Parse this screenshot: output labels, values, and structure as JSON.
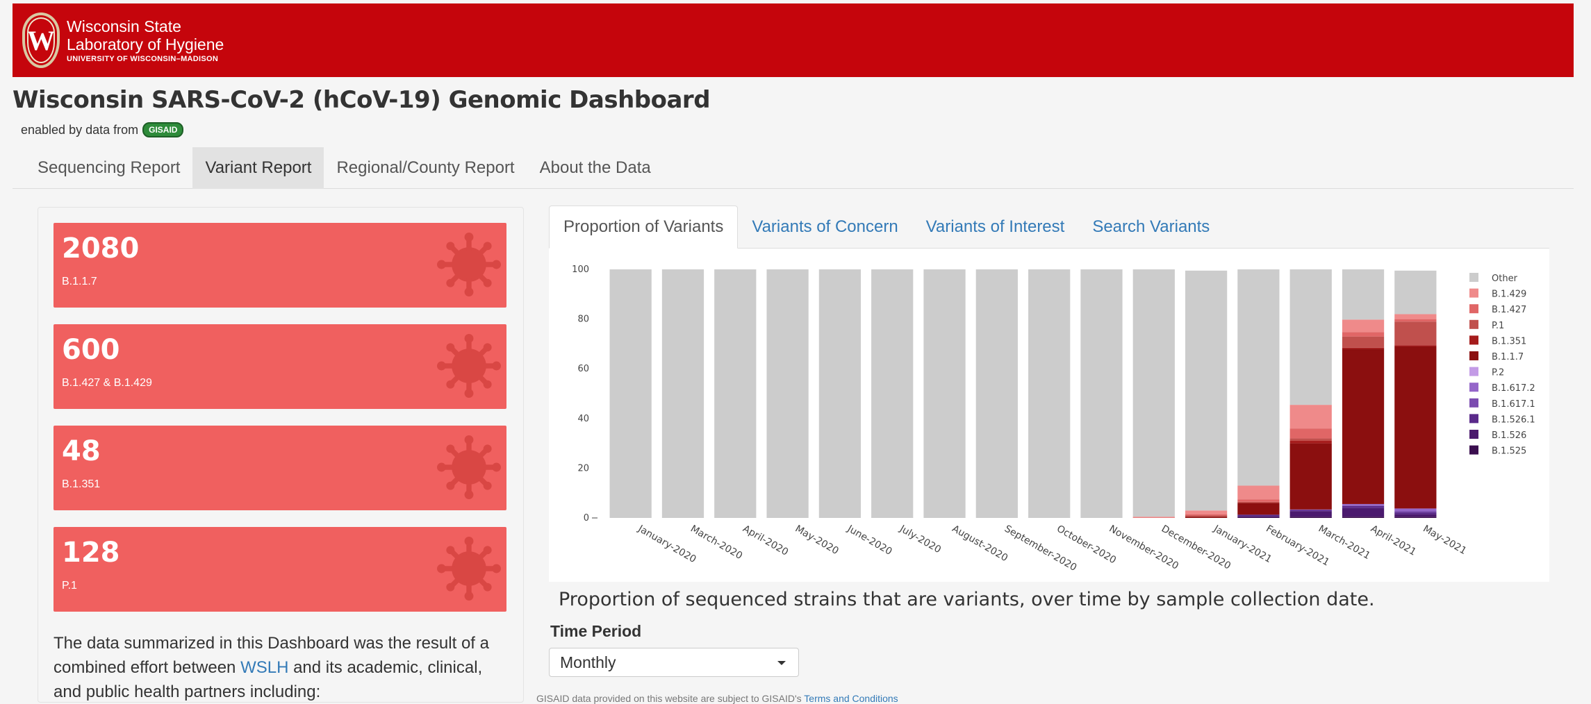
{
  "header": {
    "logo_line1": "Wisconsin State",
    "logo_line2": "Laboratory of Hygiene",
    "logo_line3": "UNIVERSITY OF WISCONSIN–MADISON",
    "logo_letter": "W",
    "brand_color": "#c5050c"
  },
  "page_title": "Wisconsin SARS-CoV-2 (hCoV-19) Genomic Dashboard",
  "enabled_by": "enabled by data from",
  "gisaid_badge": "GISAID",
  "nav_tabs": [
    {
      "label": "Sequencing Report",
      "active": false
    },
    {
      "label": "Variant Report",
      "active": true
    },
    {
      "label": "Regional/County Report",
      "active": false
    },
    {
      "label": "About the Data",
      "active": false
    }
  ],
  "variant_boxes": [
    {
      "count": "2080",
      "label": "B.1.1.7"
    },
    {
      "count": "600",
      "label": "B.1.427 & B.1.429"
    },
    {
      "count": "48",
      "label": "B.1.351"
    },
    {
      "count": "128",
      "label": "P.1"
    }
  ],
  "sidebar_text": {
    "before_link": "The data summarized in this Dashboard was the result of a combined effort between ",
    "link": "WSLH",
    "after_link": " and its academic, clinical, and public health partners including:"
  },
  "main_tabs": [
    {
      "label": "Proportion of Variants",
      "active": true
    },
    {
      "label": "Variants of Concern",
      "active": false
    },
    {
      "label": "Variants of Interest",
      "active": false
    },
    {
      "label": "Search Variants",
      "active": false
    }
  ],
  "chart_caption": "Proportion of sequenced strains that are variants, over time by sample collection date.",
  "time_period": {
    "label": "Time Period",
    "selected": "Monthly"
  },
  "footnote": {
    "text": "GISAID data provided on this website are subject to GISAID's ",
    "link": "Terms and Conditions"
  },
  "chart_data": {
    "type": "bar",
    "stacked": true,
    "ylim": [
      0,
      100
    ],
    "yticks": [
      0,
      20,
      40,
      60,
      80,
      100
    ],
    "categories": [
      "January-2020",
      "March-2020",
      "April-2020",
      "May-2020",
      "June-2020",
      "July-2020",
      "August-2020",
      "September-2020",
      "October-2020",
      "November-2020",
      "December-2020",
      "January-2021",
      "February-2021",
      "March-2021",
      "April-2021",
      "May-2021"
    ],
    "legend_position": "right",
    "series": [
      {
        "name": "B.1.525",
        "color": "#3b0f4f",
        "values": [
          0,
          0,
          0,
          0,
          0,
          0,
          0,
          0,
          0,
          0,
          0,
          0,
          0.3,
          0.5,
          0.5,
          0.5
        ]
      },
      {
        "name": "B.1.526",
        "color": "#4b1a6e",
        "values": [
          0,
          0,
          0,
          0,
          0,
          0,
          0,
          0,
          0,
          0,
          0,
          0,
          0.5,
          2.2,
          3.5,
          1.0
        ]
      },
      {
        "name": "B.1.526.1",
        "color": "#5a2a8a",
        "values": [
          0,
          0,
          0,
          0,
          0,
          0,
          0,
          0,
          0,
          0,
          0,
          0,
          0.5,
          0.5,
          0.8,
          0.8
        ]
      },
      {
        "name": "B.1.617.1",
        "color": "#7b4cb0",
        "values": [
          0,
          0,
          0,
          0,
          0,
          0,
          0,
          0,
          0,
          0,
          0,
          0,
          0,
          0,
          0.3,
          0.5
        ]
      },
      {
        "name": "B.1.617.2",
        "color": "#9466c9",
        "values": [
          0,
          0,
          0,
          0,
          0,
          0,
          0,
          0,
          0,
          0,
          0,
          0,
          0,
          0.2,
          0.5,
          1.0
        ]
      },
      {
        "name": "P.2",
        "color": "#c39be6",
        "values": [
          0,
          0,
          0,
          0,
          0,
          0,
          0,
          0,
          0,
          0,
          0,
          0,
          0,
          0,
          0,
          0
        ]
      },
      {
        "name": "B.1.1.7",
        "color": "#8b0f0f",
        "values": [
          0,
          0,
          0,
          0,
          0,
          0,
          0,
          0,
          0,
          0,
          0,
          0.5,
          4.7,
          26.6,
          62.4,
          65.2
        ]
      },
      {
        "name": "B.1.351",
        "color": "#a51c1c",
        "values": [
          0,
          0,
          0,
          0,
          0,
          0,
          0,
          0,
          0,
          0,
          0,
          0,
          0,
          1.0,
          0.5,
          0.5
        ]
      },
      {
        "name": "P.1",
        "color": "#c0504d",
        "values": [
          0,
          0,
          0,
          0,
          0,
          0,
          0,
          0,
          0,
          0,
          0,
          0.5,
          0.5,
          1.0,
          4.5,
          9.5
        ]
      },
      {
        "name": "B.1.427",
        "color": "#e06666",
        "values": [
          0,
          0,
          0,
          0,
          0,
          0,
          0,
          0,
          0,
          0,
          0.2,
          0.5,
          1.0,
          4.0,
          1.8,
          1.0
        ]
      },
      {
        "name": "B.1.429",
        "color": "#ef8a8a",
        "values": [
          0,
          0,
          0,
          0,
          0,
          0,
          0,
          0,
          0,
          0,
          0.3,
          1.5,
          5.5,
          9.5,
          5.0,
          2.0
        ]
      },
      {
        "name": "Other",
        "color": "#cccccc",
        "values": [
          100,
          100,
          100,
          100,
          100,
          100,
          100,
          100,
          100,
          100,
          99.5,
          96.5,
          87,
          54.5,
          20.2,
          17.5
        ]
      }
    ]
  }
}
